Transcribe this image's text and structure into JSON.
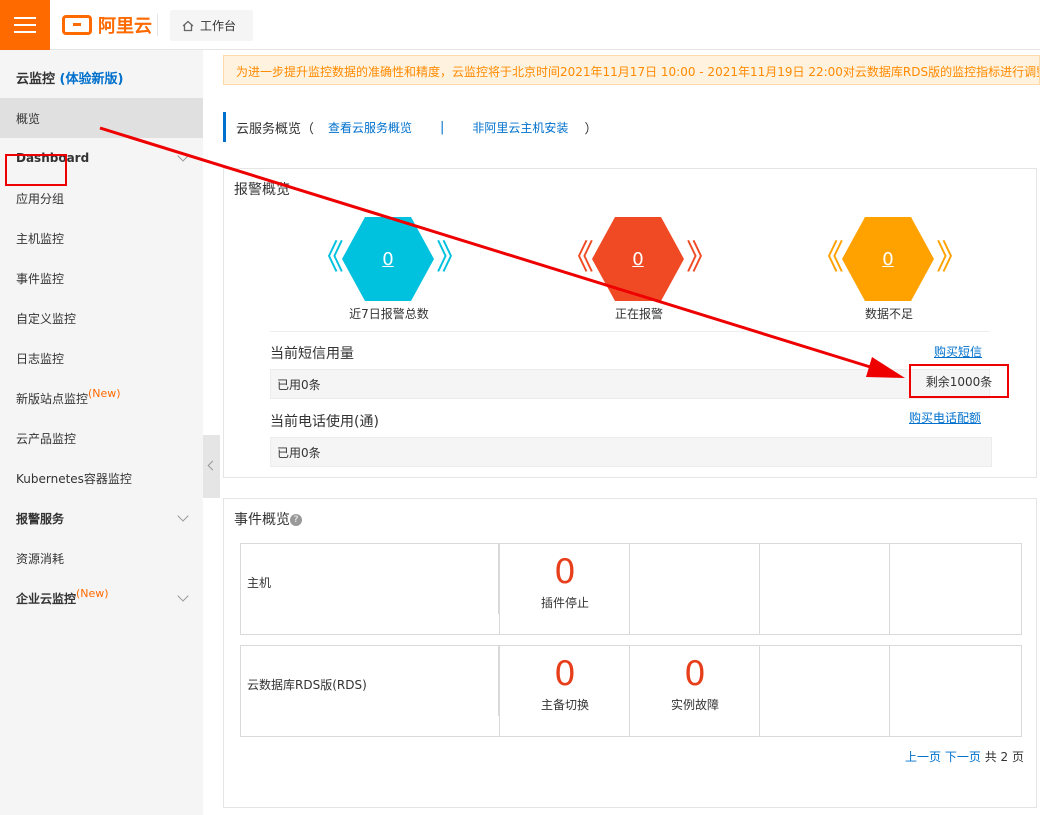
{
  "header": {
    "logo_text": "阿里云",
    "workspace_label": "工作台"
  },
  "sidebar": {
    "title_main": "云监控",
    "title_badge": "(体验新版)",
    "items": [
      {
        "label": "概览"
      },
      {
        "label": "Dashboard"
      },
      {
        "label": "应用分组"
      },
      {
        "label": "主机监控"
      },
      {
        "label": "事件监控"
      },
      {
        "label": "自定义监控"
      },
      {
        "label": "日志监控"
      },
      {
        "label": "新版站点监控",
        "badge": "(New)"
      },
      {
        "label": "云产品监控"
      },
      {
        "label": "Kubernetes容器监控"
      },
      {
        "label": "报警服务"
      },
      {
        "label": "资源消耗"
      },
      {
        "label": "企业云监控",
        "badge": "(New)"
      }
    ]
  },
  "notice": "为进一步提升监控数据的准确性和精度，云监控将于北京时间2021年11月17日 10:00 - 2021年11月19日 22:00对云数据库RDS版的监控指标进行调整与升级",
  "service_overview": {
    "title": "云服务概览（",
    "link1": "查看云服务概览",
    "sep": "|",
    "link2": "非阿里云主机安装",
    "close": "）"
  },
  "alarm_overview": {
    "title": "报警概览",
    "stats": [
      {
        "value": "0",
        "label": "近7日报警总数",
        "color": "#00c1de"
      },
      {
        "value": "0",
        "label": "正在报警",
        "color": "#f04a24"
      },
      {
        "value": "0",
        "label": "数据不足",
        "color": "#ffa200"
      }
    ],
    "sms": {
      "title": "当前短信用量",
      "buy_link": "购买短信",
      "used": "已用0条",
      "remain": "剩余1000条"
    },
    "phone": {
      "title": "当前电话使用(通)",
      "buy_link": "购买电话配额",
      "used": "已用0条"
    }
  },
  "event_overview": {
    "title": "事件概览",
    "help": "?",
    "rows": [
      {
        "name": "主机",
        "cells": [
          {
            "value": "0",
            "caption": "插件停止"
          }
        ]
      },
      {
        "name": "云数据库RDS版(RDS)",
        "cells": [
          {
            "value": "0",
            "caption": "主备切换"
          },
          {
            "value": "0",
            "caption": "实例故障"
          }
        ]
      }
    ],
    "pager": {
      "prev": "上一页",
      "next": "下一页",
      "total": "共 2 页"
    }
  }
}
